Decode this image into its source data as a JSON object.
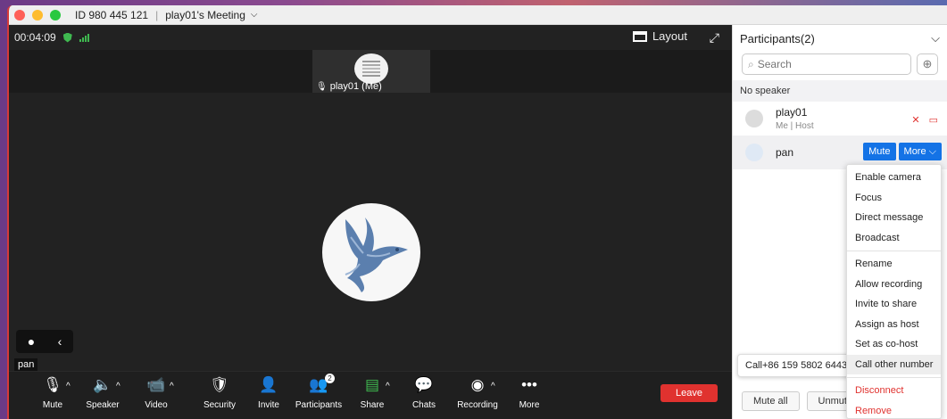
{
  "window": {
    "meeting_id": "ID 980 445 121",
    "separator": "|",
    "meeting_title": "play01's Meeting",
    "title_caret": "⌵"
  },
  "video": {
    "timer": "00:04:09",
    "layout_label": "Layout",
    "expand_glyph": "⤢",
    "thumb_name": "play01 (Me)",
    "name_tag": "pan",
    "chat_icon": "●",
    "collapse_icon": "‹"
  },
  "toolbar": {
    "buttons": [
      {
        "icon": "🎙",
        "label": "Mute",
        "caret": "^"
      },
      {
        "icon": "🔈",
        "label": "Speaker",
        "caret": "^"
      },
      {
        "icon": "📹",
        "label": "Video",
        "caret": "^"
      },
      {
        "icon": "🛡",
        "label": "Security",
        "caret": ""
      },
      {
        "icon": "👤",
        "label": "Invite",
        "caret": ""
      },
      {
        "icon": "👥",
        "label": "Participants",
        "caret": "",
        "badge": "2"
      },
      {
        "icon": "▤",
        "label": "Share",
        "caret": "^"
      },
      {
        "icon": "💬",
        "label": "Chats",
        "caret": ""
      },
      {
        "icon": "◉",
        "label": "Recording",
        "caret": "^"
      },
      {
        "icon": "•••",
        "label": "More",
        "caret": ""
      }
    ],
    "leave_label": "Leave"
  },
  "panel": {
    "title": "Participants(2)",
    "chevron": "⌵",
    "search_placeholder": "Search",
    "search_glyph": "⌕",
    "invite_glyph": "⊕",
    "no_speaker": "No speaker",
    "participants": [
      {
        "name": "play01",
        "sub": "Me | Host",
        "mic_icon": "✕",
        "cam_icon": "▭"
      },
      {
        "name": "pan",
        "sub": "",
        "mute_label": "Mute",
        "more_label": "More ⌵"
      }
    ],
    "footer": {
      "mute_all": "Mute all",
      "unmute": "Unmute"
    }
  },
  "tooltip": "Call+86 159 5802 6443",
  "menu": {
    "group1": [
      "Enable camera",
      "Focus",
      "Direct message",
      "Broadcast"
    ],
    "group2": [
      "Rename",
      "Allow recording",
      "Invite to share",
      "Assign as host",
      "Set as co-host",
      "Call other number"
    ],
    "group3": [
      "Disconnect",
      "Remove"
    ]
  },
  "colors": {
    "accent": "#1473e6",
    "danger": "#e0322f",
    "ok": "#3fb950"
  }
}
